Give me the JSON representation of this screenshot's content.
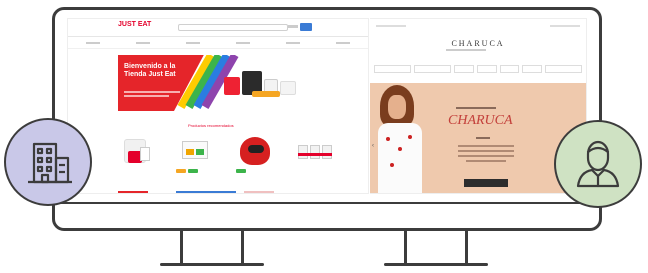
{
  "store": {
    "logo": "JUST EAT",
    "hero_title": "Bienvenido a la Tienda Just Eat",
    "section_title": "Productos recomendados"
  },
  "fashion": {
    "brand": "CHARUCA"
  },
  "icons": {
    "left": "office-building-icon",
    "right": "user-icon"
  },
  "colors": {
    "store_red": "#e4002b",
    "left_circle": "#c9c8e8",
    "right_circle": "#cfe2c3",
    "fashion_bg": "#efc9ad"
  }
}
